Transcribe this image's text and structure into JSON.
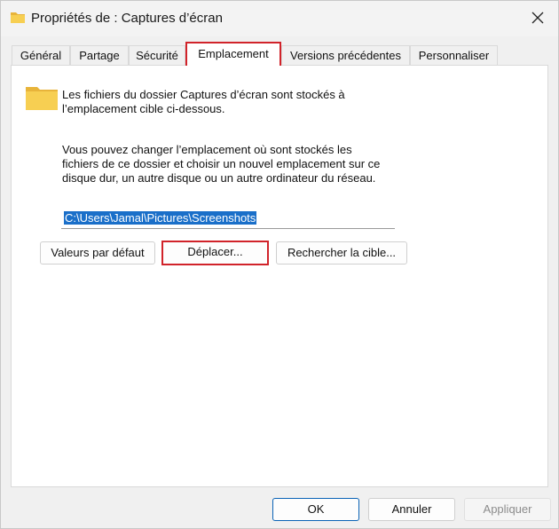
{
  "window": {
    "title": "Propriétés de : Captures d’écran"
  },
  "tabs": [
    {
      "label": "Général",
      "selected": false
    },
    {
      "label": "Partage",
      "selected": false
    },
    {
      "label": "Sécurité",
      "selected": false
    },
    {
      "label": "Emplacement",
      "selected": true
    },
    {
      "label": "Versions précédentes",
      "selected": false
    },
    {
      "label": "Personnaliser",
      "selected": false
    }
  ],
  "location": {
    "intro_line1": "Les fichiers du dossier Captures d’écran sont stockés à",
    "intro_line2": "l’emplacement cible ci-dessous.",
    "desc_line1": "Vous pouvez changer l’emplacement où sont stockés les",
    "desc_line2": "fichiers de ce dossier et choisir un nouvel emplacement sur ce",
    "desc_line3": "disque dur, un autre disque ou un autre ordinateur du réseau.",
    "path_value": "C:\\Users\\Jamal\\Pictures\\Screenshots",
    "restore_default_label": "Valeurs par défaut",
    "move_label": "Déplacer...",
    "find_target_label": "Rechercher la cible..."
  },
  "footer": {
    "ok_label": "OK",
    "cancel_label": "Annuler",
    "apply_label": "Appliquer"
  },
  "colors": {
    "highlight": "#d1232a",
    "selection": "#1a6fc9",
    "folder": "#f5c542"
  }
}
